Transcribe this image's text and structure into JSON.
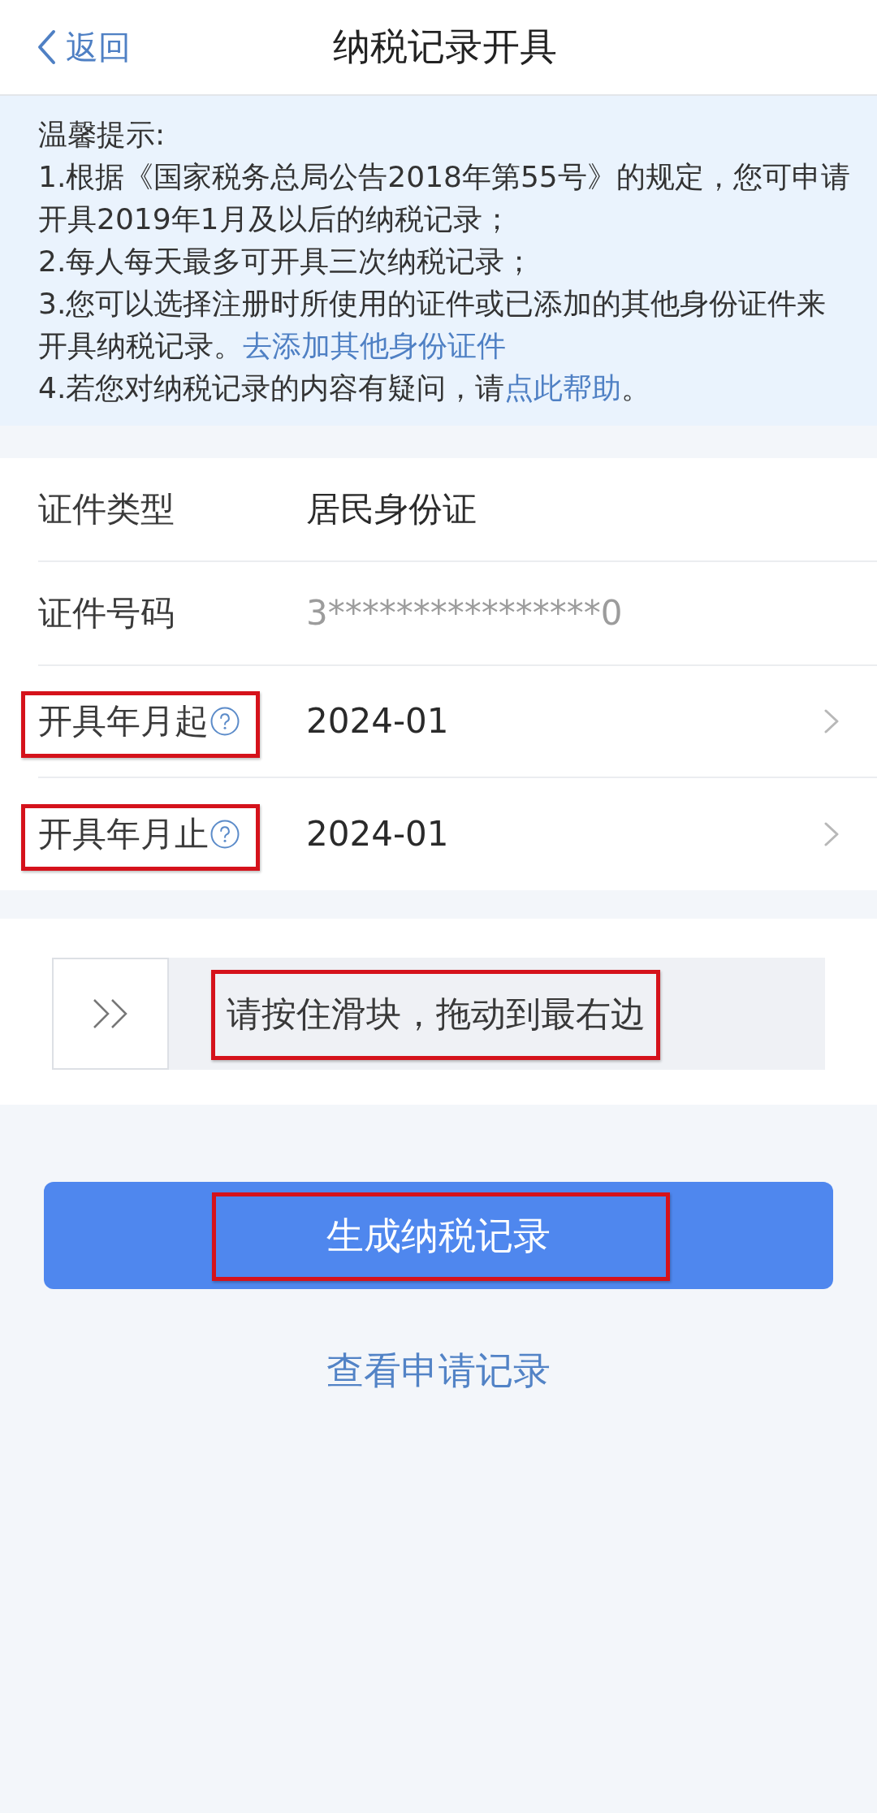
{
  "nav": {
    "back": "返回",
    "title": "纳税记录开具"
  },
  "notice": {
    "heading": "温馨提示:",
    "items": [
      {
        "text": "1.根据《国家税务总局公告2018年第55号》的规定，您可申请开具2019年1月及以后的纳税记录；"
      },
      {
        "text": "2.每人每天最多可开具三次纳税记录；"
      },
      {
        "text": "3.您可以选择注册时所使用的证件或已添加的其他身份证件来开具纳税记录。",
        "link": "去添加其他身份证件"
      },
      {
        "text": "4.若您对纳税记录的内容有疑问，请",
        "link": "点此帮助",
        "after": "。"
      }
    ]
  },
  "form": {
    "rows": [
      {
        "kind": "text",
        "label": "证件类型",
        "value": "居民身份证",
        "help": false,
        "highlighted": false
      },
      {
        "kind": "masked",
        "label": "证件号码",
        "value": "3****************0",
        "help": false,
        "highlighted": false
      },
      {
        "kind": "picker",
        "label": "开具年月起",
        "value": "2024-01",
        "help": true,
        "highlighted": true
      },
      {
        "kind": "picker",
        "label": "开具年月止",
        "value": "2024-01",
        "help": true,
        "highlighted": true
      }
    ]
  },
  "slider": {
    "hint": "请按住滑块，拖动到最右边",
    "level": 0,
    "highlighted": true
  },
  "primary_button": {
    "label": "生成纳税记录",
    "highlighted": true
  },
  "records_link": {
    "label": "查看申请记录"
  }
}
